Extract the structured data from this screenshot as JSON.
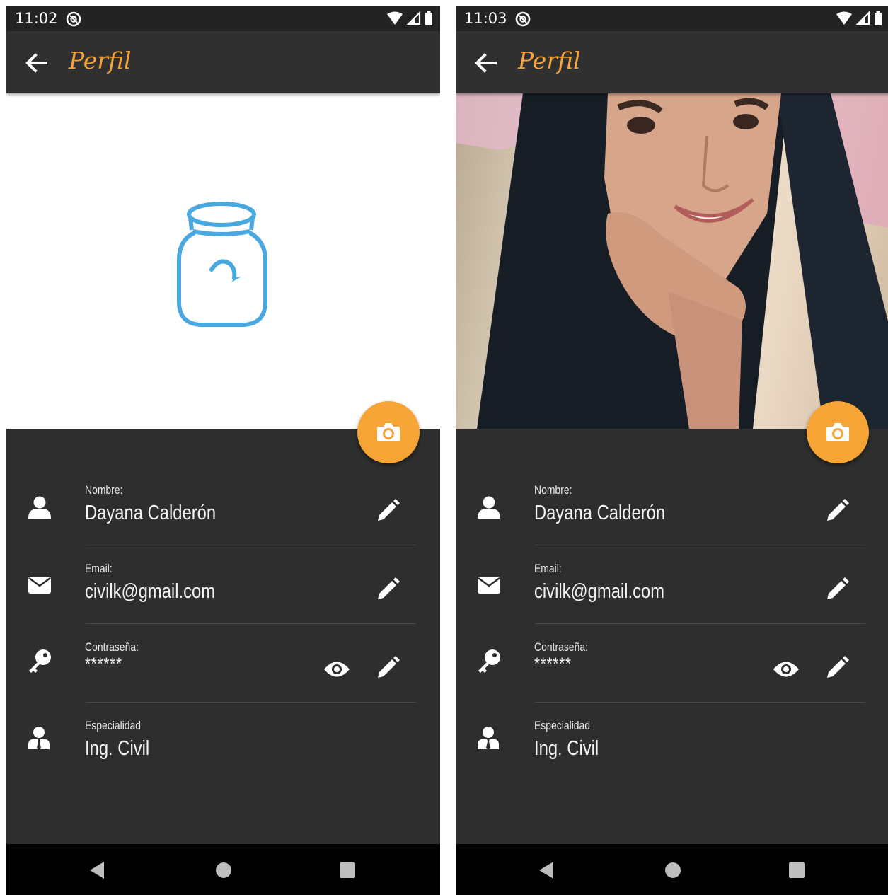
{
  "screens": [
    {
      "status_bar": {
        "time": "11:02"
      },
      "app_bar": {
        "title": "Perfil"
      },
      "photo_state": "placeholder",
      "fields": {
        "name": {
          "label": "Nombre:",
          "value": "Dayana Calderón"
        },
        "email": {
          "label": "Email:",
          "value": "civilk@gmail.com"
        },
        "password": {
          "label": "Contraseña:",
          "value": "******"
        },
        "specialty": {
          "label": "Especialidad",
          "value": "Ing. Civil"
        }
      }
    },
    {
      "status_bar": {
        "time": "11:03"
      },
      "app_bar": {
        "title": "Perfil"
      },
      "photo_state": "photo",
      "fields": {
        "name": {
          "label": "Nombre:",
          "value": "Dayana Calderón"
        },
        "email": {
          "label": "Email:",
          "value": "civilk@gmail.com"
        },
        "password": {
          "label": "Contraseña:",
          "value": "******"
        },
        "specialty": {
          "label": "Especialidad",
          "value": "Ing. Civil"
        }
      }
    }
  ],
  "icons": {
    "status": [
      "app-notification-icon",
      "wifi-icon",
      "signal-icon",
      "battery-icon"
    ],
    "app_bar": [
      "back-arrow-icon"
    ],
    "fab": "camera-icon",
    "rows": [
      "person-icon",
      "envelope-icon",
      "key-icon",
      "businessman-icon"
    ],
    "actions": [
      "pencil-icon",
      "eye-icon"
    ],
    "nav": [
      "nav-back-icon",
      "nav-home-icon",
      "nav-recents-icon"
    ]
  },
  "colors": {
    "accent": "#f7a436",
    "title": "#f5a33b",
    "background": "#2e2e2e",
    "app_bar": "#303030",
    "placeholder_icon": "#4aa8e0"
  }
}
